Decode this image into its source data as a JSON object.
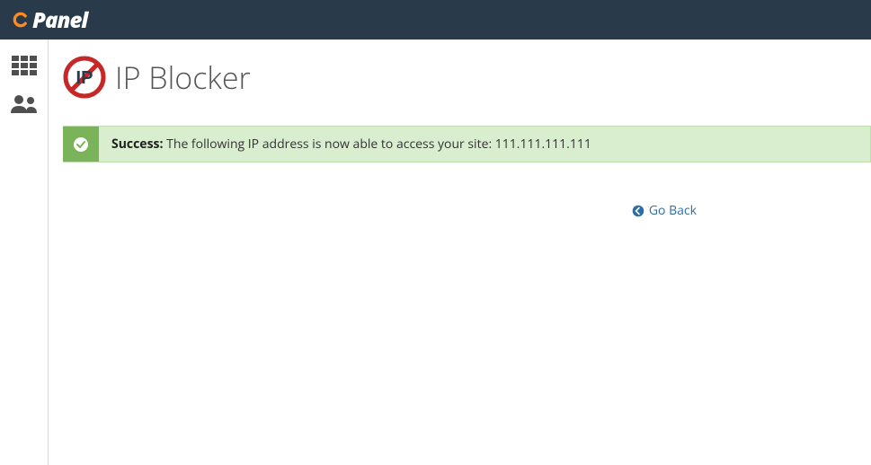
{
  "header": {
    "brand": "cPanel"
  },
  "page": {
    "title": "IP Blocker"
  },
  "alert": {
    "label": "Success:",
    "message": "The following IP address is now able to access your site: 111.111.111.111"
  },
  "actions": {
    "go_back": "Go Back"
  }
}
